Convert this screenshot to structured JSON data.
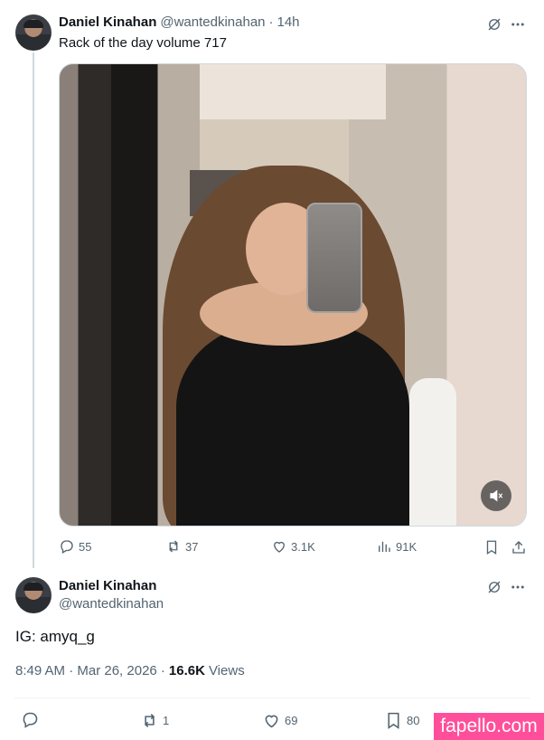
{
  "tweet": {
    "author_name": "Daniel Kinahan",
    "author_handle": "@wantedkinahan",
    "separator": "·",
    "time_ago": "14h",
    "text": "Rack of the day volume 717",
    "stats": {
      "replies": "55",
      "retweets": "37",
      "likes": "3.1K",
      "views": "91K"
    }
  },
  "reply": {
    "author_name": "Daniel Kinahan",
    "author_handle": "@wantedkinahan",
    "text": "IG: amyq_g",
    "timestamp": "8:49 AM · Mar 26, 2026 ·",
    "views_count": "16.6K",
    "views_label": "Views",
    "stats": {
      "retweets": "1",
      "likes": "69",
      "bookmarks": "80"
    }
  },
  "watermark": "fapello.com",
  "icons": [
    "grok-icon",
    "more-icon",
    "reply-icon",
    "retweet-icon",
    "like-icon",
    "views-icon",
    "bookmark-icon",
    "share-icon",
    "mute-icon"
  ],
  "colors": {
    "text": "#0f1419",
    "muted": "#536471",
    "border": "#cfd9de",
    "watermark_bg": "#ff4f9a"
  }
}
